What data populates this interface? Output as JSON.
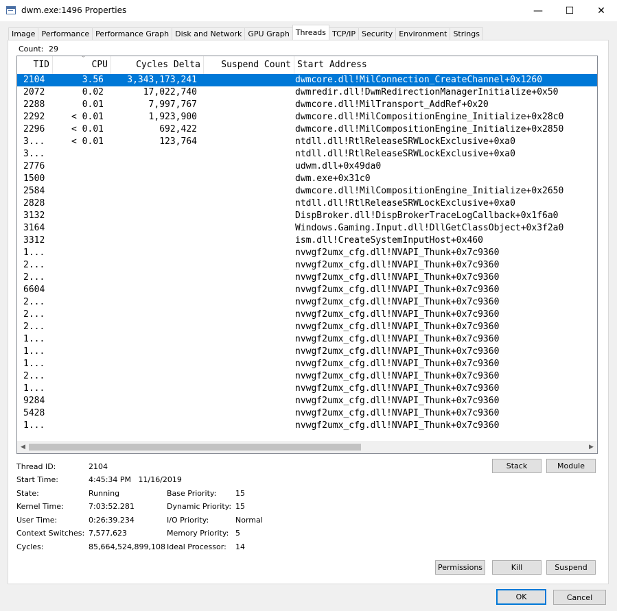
{
  "window": {
    "title": "dwm.exe:1496 Properties",
    "minimize": "—",
    "maximize": "☐",
    "close": "✕"
  },
  "tabs": [
    "Image",
    "Performance",
    "Performance Graph",
    "Disk and Network",
    "GPU Graph",
    "Threads",
    "TCP/IP",
    "Security",
    "Environment",
    "Strings"
  ],
  "active_tab": "Threads",
  "count": {
    "label": "Count:",
    "value": "29"
  },
  "columns": {
    "tid": "TID",
    "cpu": "CPU",
    "cycles": "Cycles Delta",
    "suspend": "Suspend Count",
    "start": "Start Address"
  },
  "threads": [
    {
      "tid": "2104",
      "cpu": "3.56",
      "cycles": "3,343,173,241",
      "start": "dwmcore.dll!MilConnection_CreateChannel+0x1260",
      "selected": true
    },
    {
      "tid": "2072",
      "cpu": "0.02",
      "cycles": "17,022,740",
      "start": "dwmredir.dll!DwmRedirectionManagerInitialize+0x50"
    },
    {
      "tid": "2288",
      "cpu": "0.01",
      "cycles": "7,997,767",
      "start": "dwmcore.dll!MilTransport_AddRef+0x20"
    },
    {
      "tid": "2292",
      "cpu": "< 0.01",
      "cycles": "1,923,900",
      "start": "dwmcore.dll!MilCompositionEngine_Initialize+0x28c0"
    },
    {
      "tid": "2296",
      "cpu": "< 0.01",
      "cycles": "692,422",
      "start": "dwmcore.dll!MilCompositionEngine_Initialize+0x2850"
    },
    {
      "tid": "3...",
      "cpu": "< 0.01",
      "cycles": "123,764",
      "start": "ntdll.dll!RtlReleaseSRWLockExclusive+0xa0"
    },
    {
      "tid": "3...",
      "cpu": "",
      "cycles": "",
      "start": "ntdll.dll!RtlReleaseSRWLockExclusive+0xa0"
    },
    {
      "tid": "2776",
      "cpu": "",
      "cycles": "",
      "start": "udwm.dll+0x49da0"
    },
    {
      "tid": "1500",
      "cpu": "",
      "cycles": "",
      "start": "dwm.exe+0x31c0"
    },
    {
      "tid": "2584",
      "cpu": "",
      "cycles": "",
      "start": "dwmcore.dll!MilCompositionEngine_Initialize+0x2650"
    },
    {
      "tid": "2828",
      "cpu": "",
      "cycles": "",
      "start": "ntdll.dll!RtlReleaseSRWLockExclusive+0xa0"
    },
    {
      "tid": "3132",
      "cpu": "",
      "cycles": "",
      "start": "DispBroker.dll!DispBrokerTraceLogCallback+0x1f6a0"
    },
    {
      "tid": "3164",
      "cpu": "",
      "cycles": "",
      "start": "Windows.Gaming.Input.dll!DllGetClassObject+0x3f2a0"
    },
    {
      "tid": "3312",
      "cpu": "",
      "cycles": "",
      "start": "ism.dll!CreateSystemInputHost+0x460"
    },
    {
      "tid": "1...",
      "cpu": "",
      "cycles": "",
      "start": "nvwgf2umx_cfg.dll!NVAPI_Thunk+0x7c9360"
    },
    {
      "tid": "2...",
      "cpu": "",
      "cycles": "",
      "start": "nvwgf2umx_cfg.dll!NVAPI_Thunk+0x7c9360"
    },
    {
      "tid": "2...",
      "cpu": "",
      "cycles": "",
      "start": "nvwgf2umx_cfg.dll!NVAPI_Thunk+0x7c9360"
    },
    {
      "tid": "6604",
      "cpu": "",
      "cycles": "",
      "start": "nvwgf2umx_cfg.dll!NVAPI_Thunk+0x7c9360"
    },
    {
      "tid": "2...",
      "cpu": "",
      "cycles": "",
      "start": "nvwgf2umx_cfg.dll!NVAPI_Thunk+0x7c9360"
    },
    {
      "tid": "2...",
      "cpu": "",
      "cycles": "",
      "start": "nvwgf2umx_cfg.dll!NVAPI_Thunk+0x7c9360"
    },
    {
      "tid": "2...",
      "cpu": "",
      "cycles": "",
      "start": "nvwgf2umx_cfg.dll!NVAPI_Thunk+0x7c9360"
    },
    {
      "tid": "1...",
      "cpu": "",
      "cycles": "",
      "start": "nvwgf2umx_cfg.dll!NVAPI_Thunk+0x7c9360"
    },
    {
      "tid": "1...",
      "cpu": "",
      "cycles": "",
      "start": "nvwgf2umx_cfg.dll!NVAPI_Thunk+0x7c9360"
    },
    {
      "tid": "1...",
      "cpu": "",
      "cycles": "",
      "start": "nvwgf2umx_cfg.dll!NVAPI_Thunk+0x7c9360"
    },
    {
      "tid": "2...",
      "cpu": "",
      "cycles": "",
      "start": "nvwgf2umx_cfg.dll!NVAPI_Thunk+0x7c9360"
    },
    {
      "tid": "1...",
      "cpu": "",
      "cycles": "",
      "start": "nvwgf2umx_cfg.dll!NVAPI_Thunk+0x7c9360"
    },
    {
      "tid": "9284",
      "cpu": "",
      "cycles": "",
      "start": "nvwgf2umx_cfg.dll!NVAPI_Thunk+0x7c9360"
    },
    {
      "tid": "5428",
      "cpu": "",
      "cycles": "",
      "start": "nvwgf2umx_cfg.dll!NVAPI_Thunk+0x7c9360"
    },
    {
      "tid": "1...",
      "cpu": "",
      "cycles": "",
      "start": "nvwgf2umx_cfg.dll!NVAPI_Thunk+0x7c9360"
    }
  ],
  "scrollbar": {
    "left_arrow": "◀",
    "right_arrow": "▶"
  },
  "details": {
    "thread_id_label": "Thread ID:",
    "thread_id": "2104",
    "start_time_label": "Start Time:",
    "start_time": "4:45:34 PM   11/16/2019",
    "state_label": "State:",
    "state": "Running",
    "kernel_time_label": "Kernel Time:",
    "kernel_time": "7:03:52.281",
    "user_time_label": "User Time:",
    "user_time": "0:26:39.234",
    "context_switches_label": "Context Switches:",
    "context_switches": "7,577,623",
    "cycles_label": "Cycles:",
    "cycles": "85,664,524,899,108",
    "base_priority_label": "Base Priority:",
    "base_priority": "15",
    "dynamic_priority_label": "Dynamic Priority:",
    "dynamic_priority": "15",
    "io_priority_label": "I/O Priority:",
    "io_priority": "Normal",
    "memory_priority_label": "Memory Priority:",
    "memory_priority": "5",
    "ideal_processor_label": "Ideal Processor:",
    "ideal_processor": "14"
  },
  "buttons": {
    "stack": "Stack",
    "module": "Module",
    "permissions": "Permissions",
    "kill": "Kill",
    "suspend": "Suspend",
    "ok": "OK",
    "cancel": "Cancel"
  },
  "colors": {
    "selection": "#0078d7",
    "default_button_border": "#0078d7"
  }
}
